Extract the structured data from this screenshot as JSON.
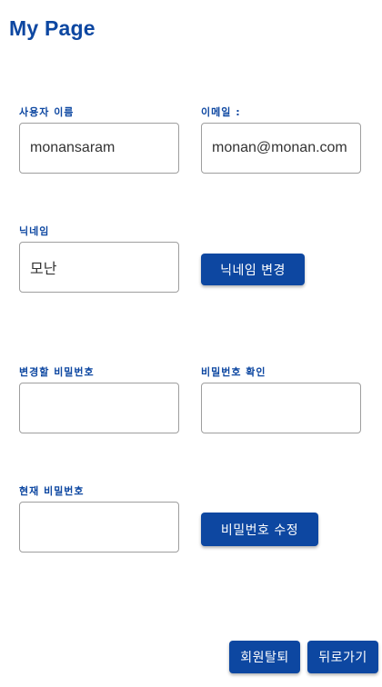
{
  "page": {
    "title": "My Page"
  },
  "username": {
    "label": "사용자 이름",
    "value": "monansaram"
  },
  "email": {
    "label": "이메일 :",
    "value": "monan@monan.com"
  },
  "nickname": {
    "label": "닉네임",
    "value": "모난",
    "change_button": "닉네임 변경"
  },
  "new_password": {
    "label": "변경할 비밀번호",
    "value": ""
  },
  "confirm_password": {
    "label": "비밀번호 확인",
    "value": ""
  },
  "current_password": {
    "label": "현재 비밀번호",
    "value": ""
  },
  "password_change_button": "비밀번호 수정",
  "footer": {
    "withdraw_button": "회원탈퇴",
    "back_button": "뒤로가기"
  },
  "colors": {
    "accent": "#0d47a1",
    "border": "#9e9e9e"
  }
}
